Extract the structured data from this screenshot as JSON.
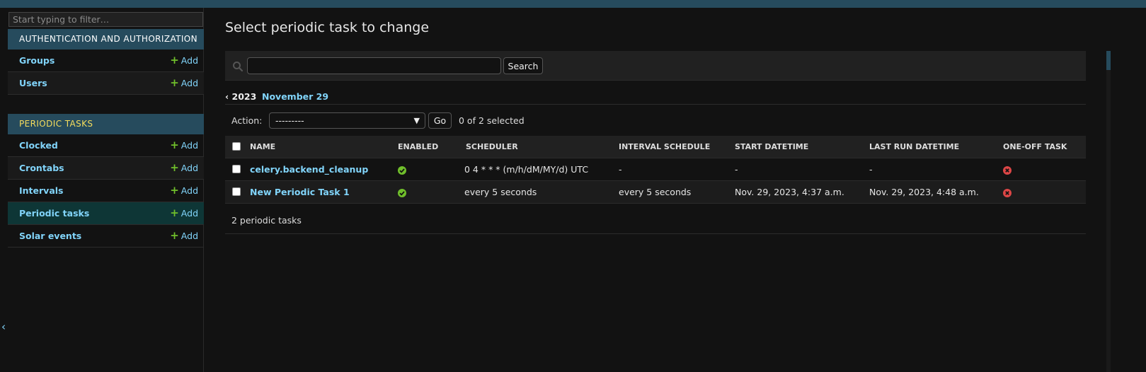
{
  "sidebar": {
    "filter_placeholder": "Start typing to filter…",
    "modules": [
      {
        "caption": "Authentication and Authorization",
        "models": [
          {
            "name": "Groups",
            "add_label": "Add"
          },
          {
            "name": "Users",
            "add_label": "Add"
          }
        ]
      },
      {
        "caption": "Periodic Tasks",
        "models": [
          {
            "name": "Clocked",
            "add_label": "Add"
          },
          {
            "name": "Crontabs",
            "add_label": "Add"
          },
          {
            "name": "Intervals",
            "add_label": "Add"
          },
          {
            "name": "Periodic tasks",
            "add_label": "Add",
            "current": true
          },
          {
            "name": "Solar events",
            "add_label": "Add"
          }
        ]
      }
    ],
    "collapse_icon": "chevron-left-icon",
    "collapse_glyph": "‹"
  },
  "content": {
    "title": "Select periodic task to change",
    "search": {
      "value": "",
      "button_label": "Search"
    },
    "date_hierarchy": {
      "back": "‹ 2023",
      "current": "November 29"
    },
    "actions": {
      "label": "Action:",
      "selected_value": "---------",
      "go_label": "Go",
      "selected_count": "0 of 2 selected"
    },
    "table": {
      "columns": [
        "Name",
        "Enabled",
        "Scheduler",
        "Interval Schedule",
        "Start Datetime",
        "Last run datetime",
        "One-off Task"
      ],
      "rows": [
        {
          "name": "celery.backend_cleanup",
          "enabled": true,
          "scheduler": "0 4 * * * (m/h/dM/MY/d) UTC",
          "interval": "-",
          "start": "-",
          "last_run": "-",
          "one_off": false
        },
        {
          "name": "New Periodic Task 1",
          "enabled": true,
          "scheduler": "every 5 seconds",
          "interval": "every 5 seconds",
          "start": "Nov. 29, 2023, 4:37 a.m.",
          "last_run": "Nov. 29, 2023, 4:48 a.m.",
          "one_off": false
        }
      ]
    },
    "paginator": "2 periodic tasks"
  },
  "colors": {
    "header": "#264b5d",
    "link": "#81d4fa",
    "caption_highlight": "#f5dd5d",
    "add_plus": "#70bf2b",
    "yes_icon": "#70bf2b",
    "no_icon": "#dd4646"
  }
}
